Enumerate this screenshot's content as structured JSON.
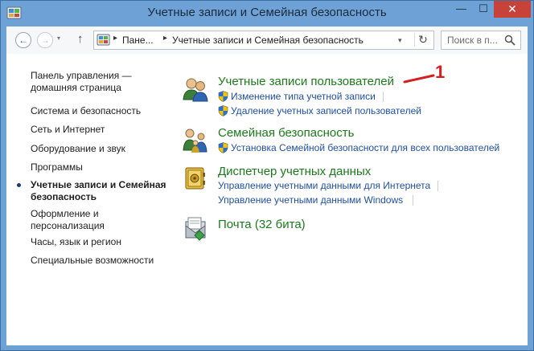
{
  "window": {
    "title": "Учетные записи и Семейная безопасность",
    "minimize_glyph": "—",
    "maximize_glyph": "☐",
    "close_glyph": "✕"
  },
  "nav": {
    "back_glyph": "←",
    "forward_glyph": "→",
    "history_glyph": "▾",
    "up_glyph": "↑"
  },
  "address": {
    "crumbs": [
      "Пане...",
      "Учетные записи и Семейная безопасность"
    ],
    "separator": "▸",
    "dropdown_glyph": "▾",
    "refresh_glyph": "↻"
  },
  "search": {
    "placeholder": "Поиск в п..."
  },
  "sidebar": {
    "items": [
      {
        "label": "Панель управления —"
      },
      {
        "label": "домашняя страница"
      },
      {
        "label": "Система и безопасность"
      },
      {
        "label": "Сеть и Интернет"
      },
      {
        "label": "Оборудование и звук"
      },
      {
        "label": "Программы"
      },
      {
        "label": "Учетные записи и Семейная"
      },
      {
        "label": "безопасность"
      },
      {
        "label": "Оформление и"
      },
      {
        "label": "персонализация"
      },
      {
        "label": "Часы, язык и регион"
      },
      {
        "label": "Специальные возможности"
      }
    ]
  },
  "categories": [
    {
      "title": "Учетные записи пользователей",
      "icon": "users-icon",
      "links": [
        "Изменение типа учетной записи",
        "Удаление учетных записей пользователей"
      ]
    },
    {
      "title": "Семейная безопасность",
      "icon": "family-safety-icon",
      "links": [
        "Установка Семейной безопасности для всех пользователей"
      ]
    },
    {
      "title": "Диспетчер учетных данных",
      "icon": "credential-vault-icon",
      "links": [
        "Управление учетными данными для Интернета",
        "Управление учетными данными Windows"
      ]
    },
    {
      "title": "Почта (32 бита)",
      "icon": "mail-icon",
      "links": []
    }
  ],
  "annotation": {
    "number": "1"
  },
  "colors": {
    "title_bar": "#6ea2d7",
    "category_title": "#1c7a1c",
    "link": "#1f4fa8",
    "annotation": "#d31f1f",
    "close_button": "#c7433a"
  }
}
